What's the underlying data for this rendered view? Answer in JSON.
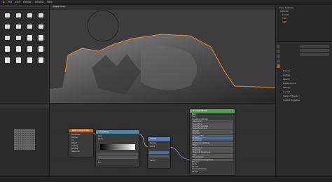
{
  "topbar": {
    "menus": [
      "File",
      "Edit",
      "Render",
      "Window",
      "Help"
    ]
  },
  "file_browser": {
    "items": [
      {
        "label": "..",
        "kind": "folder"
      },
      {
        "label": "",
        "kind": "folder"
      },
      {
        "label": "",
        "kind": "folder"
      },
      {
        "label": "",
        "kind": "folder"
      },
      {
        "label": "",
        "kind": "folder"
      },
      {
        "label": "",
        "kind": "folder"
      },
      {
        "label": "",
        "kind": "folder"
      },
      {
        "label": "",
        "kind": "folder"
      },
      {
        "label": "",
        "kind": "folder"
      },
      {
        "label": "",
        "kind": "folder"
      },
      {
        "label": "",
        "kind": "file"
      },
      {
        "label": "",
        "kind": "file"
      },
      {
        "label": "",
        "kind": "file"
      },
      {
        "label": "",
        "kind": "file"
      },
      {
        "label": "",
        "kind": "file"
      },
      {
        "label": "",
        "kind": "file"
      },
      {
        "label": "",
        "kind": "file"
      },
      {
        "label": "",
        "kind": "file"
      },
      {
        "label": "",
        "kind": "file"
      },
      {
        "label": "",
        "kind": "file"
      }
    ]
  },
  "viewport": {
    "header": "Object Mode"
  },
  "outliner": {
    "rows": [
      "Scene Collection",
      "Collection",
      "Camera",
      "Cube",
      "Light"
    ]
  },
  "properties": {
    "rows": [
      "Preview",
      "Surface",
      "Volume",
      "Displacement",
      "Settings",
      "Line Art",
      "Viewport Display",
      "Custom Properties"
    ]
  },
  "nodes": {
    "texcoord": {
      "title": "Texture Coordinate",
      "color": "#b5692e",
      "rows": [
        "Generated",
        "Normal",
        "UV",
        "Object",
        "Camera",
        "Window",
        "Reflection"
      ]
    },
    "colorramp": {
      "title": "ColorRamp",
      "color": "#4a8aa8",
      "rows": [
        "Color",
        "Alpha",
        "Fac"
      ]
    },
    "noise": {
      "title": "Bump",
      "color": "#5a7dbf",
      "rows": [
        "Normal",
        "Invert",
        "Strength",
        "Distance",
        "Height"
      ]
    },
    "bsdf": {
      "title": "Principled BSDF",
      "color": "#5aa05a",
      "rows": [
        "BSDF",
        "GGX",
        "Christensen-Burley",
        "Base Color",
        "Subsurface",
        "Subsurface Radius",
        "Subsurface Color",
        "Metallic",
        "Specular",
        "Specular Tint",
        "Roughness",
        "Anisotropic",
        "Anisotropic Rotation",
        "Sheen",
        "Sheen Tint",
        "Clearcoat",
        "Clearcoat Roughness",
        "IOR",
        "Transmission",
        "Transmission Roughness",
        "Emission",
        "Alpha",
        "Normal",
        "Clearcoat Normal",
        "Tangent"
      ]
    }
  },
  "colors": {
    "selection_outline": "#e8892b"
  }
}
